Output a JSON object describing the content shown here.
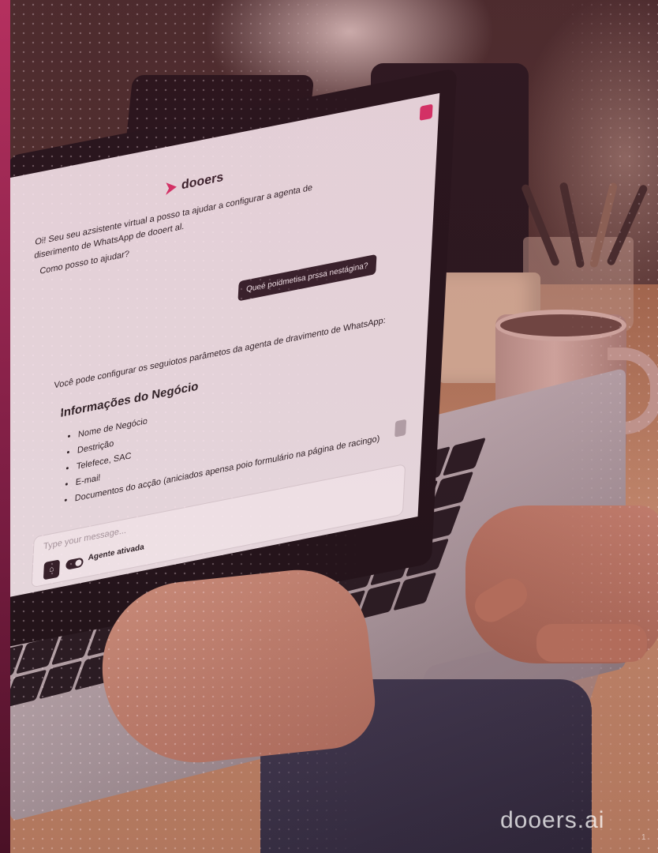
{
  "brand": {
    "name": "dooers",
    "accent": "#e0336a",
    "website": "dooers.ai"
  },
  "chat": {
    "greeting": "Oi! Seu seu azsistente virtual a posso ta ajudar a configurar a agenta de diserimento de WhatsApp de dooert al.",
    "prompt": "Como posso to ajudar?",
    "user_message": "Queé poidmetisa prssa nestágina?",
    "reply_intro": "Você pode configurar os seguiotos parâmetos da agenta de dravimento de WhatsApp:",
    "section_heading": "Informações do Negócio",
    "items": [
      "Nome de Negócio",
      "Destrição",
      "Telefece, SAC",
      "E-mail",
      "Documentos do acção (aniciados apensa poio formulário na página de racingo)"
    ],
    "input_placeholder": "Type your message...",
    "toggle_label": "Agente ativada"
  },
  "page_number": "1"
}
